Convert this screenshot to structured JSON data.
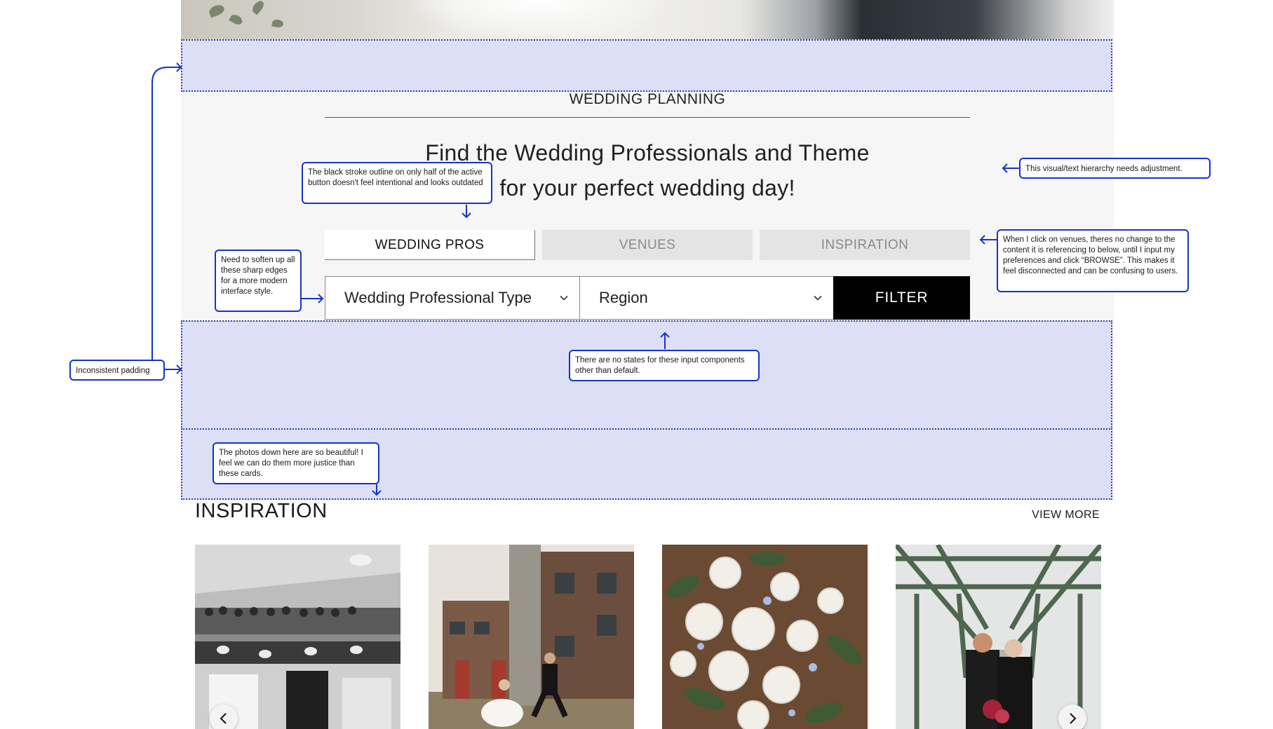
{
  "section": {
    "eyebrow": "WEDDING PLANNING",
    "headline_line1": "Find the Wedding Professionals and Theme",
    "headline_line2": "for your perfect wedding day!"
  },
  "tabs": [
    {
      "label": "WEDDING PROS",
      "active": true
    },
    {
      "label": "VENUES",
      "active": false
    },
    {
      "label": "INSPIRATION",
      "active": false
    }
  ],
  "filters": {
    "type_select": "Wedding Professional Type",
    "region_select": "Region",
    "filter_button": "FILTER"
  },
  "inspiration": {
    "title": "INSPIRATION",
    "view_more": "VIEW MORE",
    "cards": [
      "ballroom-photo",
      "factory-couple-photo",
      "white-roses-photo",
      "bridge-couple-photo"
    ]
  },
  "annotations": {
    "padding": "Inconsistent padding",
    "stroke": "The black stroke outline on only half of the active button doesn't feel intentional and looks outdated",
    "edges": "Need to soften up all these sharp edges for a more modern interface style.",
    "states": "There are no states for these input components other than default.",
    "photos": "The photos down here are so beautiful! I feel we can do them more justice than these cards.",
    "hierarchy": "This visual/text hierarchy needs adjustment.",
    "venues": "When I click on venues, theres no change to the content it is referencing to below, until I input my preferences and click “BROWSE”. This makes it feel disconnected and can be confusing to users."
  },
  "colors": {
    "annotation_blue": "#1833c9",
    "highlight_fill": "#dcdff6",
    "filter_button_bg": "#000000",
    "section_bg": "#f6f6f6"
  }
}
